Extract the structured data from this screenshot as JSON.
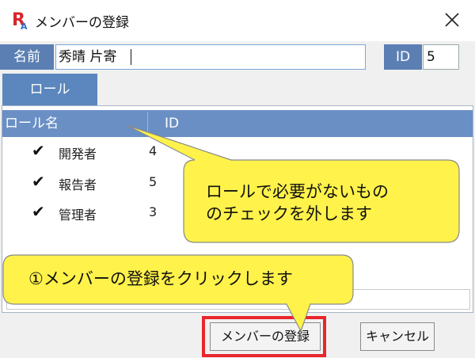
{
  "window": {
    "title": "メンバーの登録",
    "logo_letters": "RA"
  },
  "form": {
    "name_label": "名前",
    "name_value": "秀晴 片寄",
    "id_label": "ID",
    "id_value": "5"
  },
  "tabs": [
    {
      "label": "ロール"
    }
  ],
  "table": {
    "columns": [
      "ロール名",
      "ID"
    ],
    "rows": [
      {
        "name": "開発者",
        "id": "4",
        "checked": true
      },
      {
        "name": "報告者",
        "id": "5",
        "checked": true
      },
      {
        "name": "管理者",
        "id": "3",
        "checked": true
      }
    ]
  },
  "buttons": {
    "register": "メンバーの登録",
    "cancel": "キャンセル"
  },
  "callouts": {
    "uncheck_roles": "ロールで必要がないもの\nのチェックを外します",
    "click_register": "①メンバーの登録をクリックします"
  },
  "colors": {
    "header_blue": "#6a8fc4",
    "label_blue": "#5b7fb3",
    "callout_yellow": "#fff24a",
    "highlight_red": "#e8262b"
  }
}
